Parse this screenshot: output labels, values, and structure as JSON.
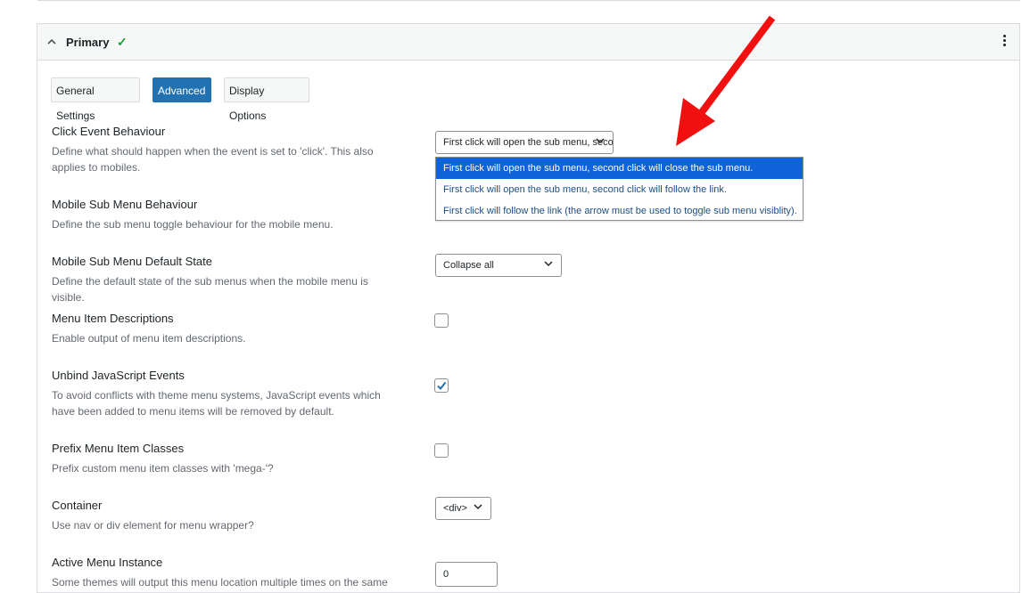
{
  "panel": {
    "title": "Primary"
  },
  "tabs": [
    {
      "label": "General Settings",
      "active": false
    },
    {
      "label": "Advanced",
      "active": true
    },
    {
      "label": "Display Options",
      "active": false
    }
  ],
  "settings": {
    "click_event": {
      "title": "Click Event Behaviour",
      "desc": "Define what should happen when the event is set to 'click'. This also applies to mobiles.",
      "value": "First click will open the sub menu, second click will close the sub menu.",
      "options": [
        "First click will open the sub menu, second click will close the sub menu.",
        "First click will open the sub menu, second click will follow the link.",
        "First click will follow the link (the arrow must be used to toggle sub menu visiblity)."
      ]
    },
    "mobile_sub_menu": {
      "title": "Mobile Sub Menu Behaviour",
      "desc": "Define the sub menu toggle behaviour for the mobile menu."
    },
    "mobile_default_state": {
      "title": "Mobile Sub Menu Default State",
      "desc": "Define the default state of the sub menus when the mobile menu is visible.",
      "value": "Collapse all"
    },
    "descriptions": {
      "title": "Menu Item Descriptions",
      "desc": "Enable output of menu item descriptions.",
      "checked": false
    },
    "unbind_js": {
      "title": "Unbind JavaScript Events",
      "desc": "To avoid conflicts with theme menu systems, JavaScript events which have been added to menu items will be removed by default.",
      "checked": true
    },
    "prefix_classes": {
      "title": "Prefix Menu Item Classes",
      "desc": "Prefix custom menu item classes with 'mega-'?",
      "checked": false
    },
    "container": {
      "title": "Container",
      "desc": "Use nav or div element for menu wrapper?",
      "value": "<div>"
    },
    "active_instance": {
      "title": "Active Menu Instance",
      "desc": "Some themes will output this menu location multiple times on the same",
      "value": "0"
    }
  },
  "colors": {
    "accent": "#2271b1",
    "success": "#1f9d36",
    "annotation": "#f01010",
    "highlight": "#0f62d8"
  },
  "icons": {
    "collapse": "chevron-up-icon",
    "status": "check-icon",
    "more": "kebab-menu-icon",
    "select": "chevron-down-icon"
  }
}
